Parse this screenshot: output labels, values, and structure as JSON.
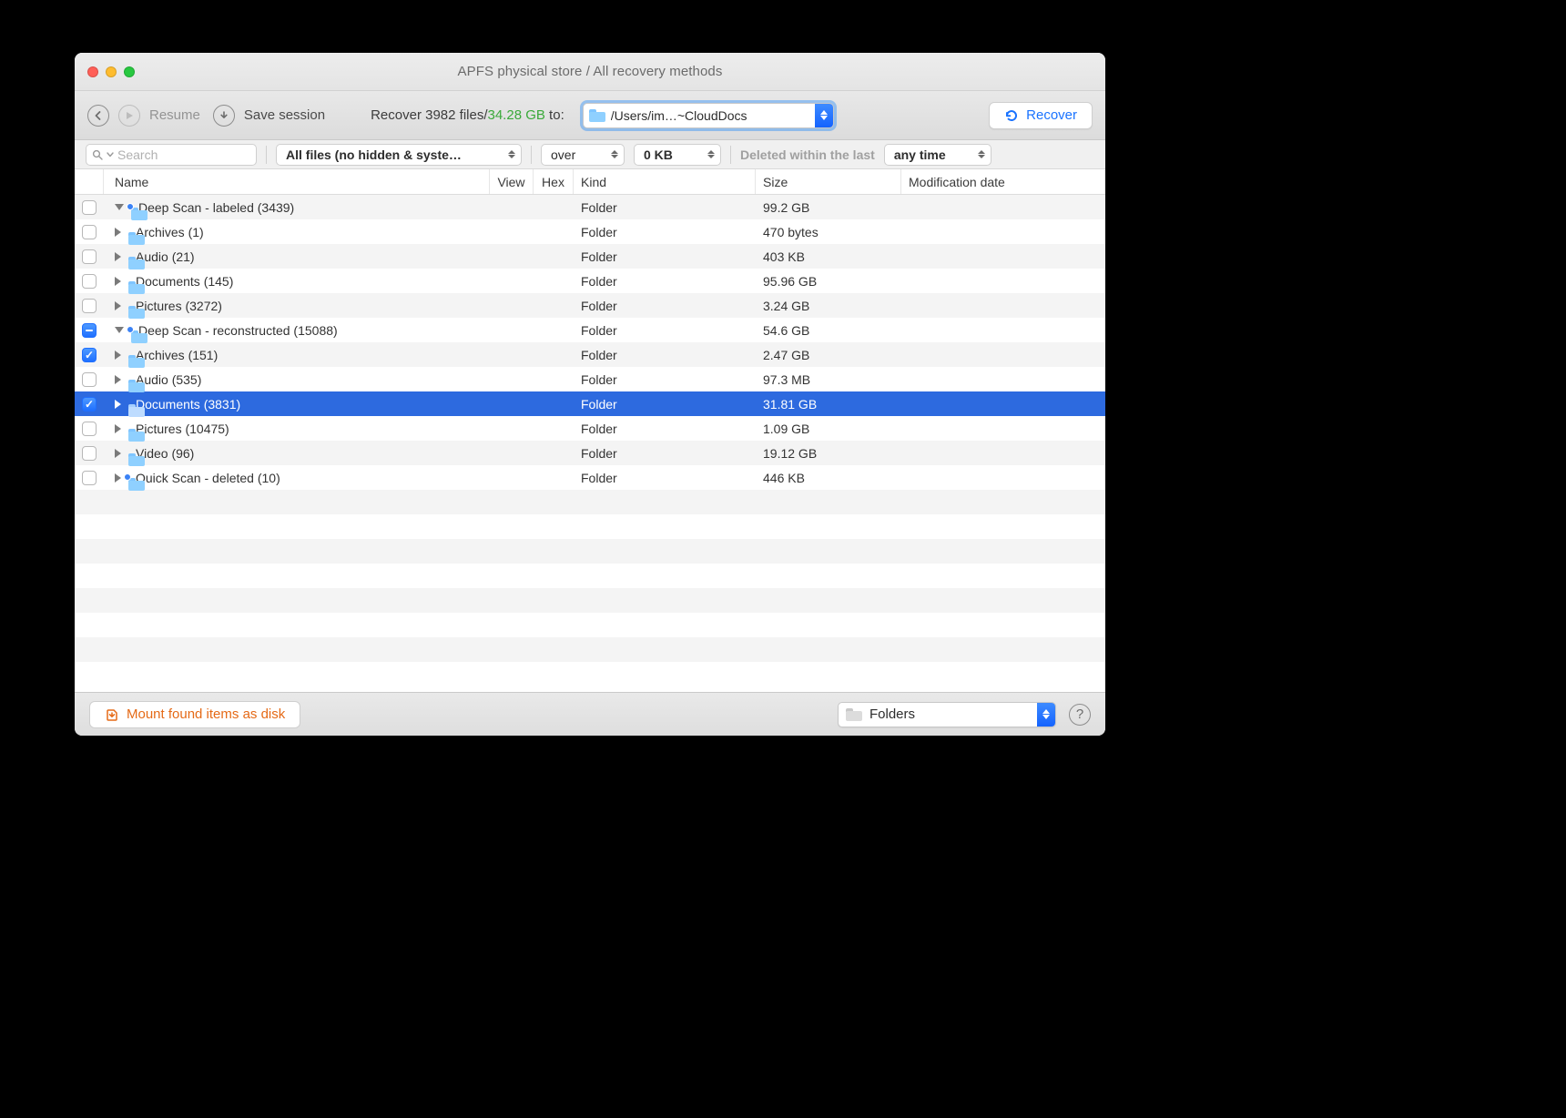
{
  "window": {
    "title": "APFS physical store / All recovery methods"
  },
  "toolbar": {
    "resume_label": "Resume",
    "save_session_label": "Save session",
    "recover_prefix": "Recover ",
    "recover_count": "3982",
    "recover_files_word": " files/",
    "recover_size": "34.28 GB",
    "recover_to": " to:",
    "destination_path": "/Users/im…~CloudDocs",
    "recover_button": "Recover"
  },
  "filter": {
    "search_placeholder": "Search",
    "files_filter": "All files (no hidden & syste…",
    "size_relation": "over",
    "size_value": "0 KB",
    "deleted_label": "Deleted within the last",
    "time_filter": "any time"
  },
  "columns": {
    "name": "Name",
    "view": "View",
    "hex": "Hex",
    "kind": "Kind",
    "size": "Size",
    "mod": "Modification date"
  },
  "rows": [
    {
      "indent": 0,
      "check": "none",
      "expand": "down",
      "badge": true,
      "name": "Deep Scan - labeled (3439)",
      "kind": "Folder",
      "size": "99.2 GB"
    },
    {
      "indent": 1,
      "check": "none",
      "expand": "right",
      "badge": false,
      "name": "Archives (1)",
      "kind": "Folder",
      "size": "470 bytes"
    },
    {
      "indent": 1,
      "check": "none",
      "expand": "right",
      "badge": false,
      "name": "Audio (21)",
      "kind": "Folder",
      "size": "403 KB"
    },
    {
      "indent": 1,
      "check": "none",
      "expand": "right",
      "badge": false,
      "name": "Documents (145)",
      "kind": "Folder",
      "size": "95.96 GB"
    },
    {
      "indent": 1,
      "check": "none",
      "expand": "right",
      "badge": false,
      "name": "Pictures (3272)",
      "kind": "Folder",
      "size": "3.24 GB"
    },
    {
      "indent": 0,
      "check": "mixed",
      "expand": "down",
      "badge": true,
      "name": "Deep Scan - reconstructed (15088)",
      "kind": "Folder",
      "size": "54.6 GB"
    },
    {
      "indent": 1,
      "check": "checked",
      "expand": "right",
      "badge": false,
      "name": "Archives (151)",
      "kind": "Folder",
      "size": "2.47 GB"
    },
    {
      "indent": 1,
      "check": "none",
      "expand": "right",
      "badge": false,
      "name": "Audio (535)",
      "kind": "Folder",
      "size": "97.3 MB"
    },
    {
      "indent": 1,
      "check": "checked",
      "expand": "right",
      "badge": false,
      "name": "Documents (3831)",
      "kind": "Folder",
      "size": "31.81 GB",
      "selected": true
    },
    {
      "indent": 1,
      "check": "none",
      "expand": "right",
      "badge": false,
      "name": "Pictures (10475)",
      "kind": "Folder",
      "size": "1.09 GB"
    },
    {
      "indent": 1,
      "check": "none",
      "expand": "right",
      "badge": false,
      "name": "Video (96)",
      "kind": "Folder",
      "size": "19.12 GB"
    },
    {
      "indent": 0,
      "check": "none",
      "expand": "right",
      "badge": true,
      "name": "Quick Scan - deleted (10)",
      "kind": "Folder",
      "size": "446 KB"
    }
  ],
  "footer": {
    "mount_label": "Mount found items as disk",
    "folders_label": "Folders"
  }
}
